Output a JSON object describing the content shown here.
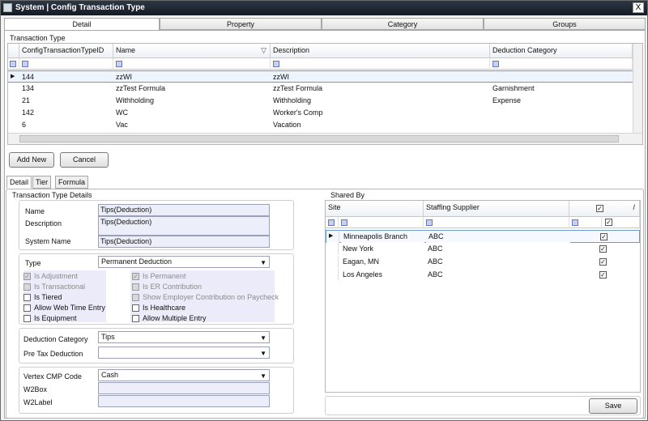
{
  "window": {
    "title": "System | Config Transaction Type",
    "close_glyph": "X"
  },
  "main_tabs": [
    "Detail",
    "Property",
    "Category",
    "Groups"
  ],
  "transaction_grid": {
    "section_label": "Transaction Type",
    "columns": [
      "ConfigTransactionTypeID",
      "Name",
      "Description",
      "Deduction Category"
    ],
    "rows": [
      [
        "144",
        "zzWI",
        "zzWI",
        ""
      ],
      [
        "134",
        "zzTest Formula",
        "zzTest Formula",
        "Garnishment"
      ],
      [
        "21",
        "Withholding",
        "Withholding",
        "Expense"
      ],
      [
        "142",
        "WC",
        "Worker's Comp",
        ""
      ],
      [
        "6",
        "Vac",
        "Vacation",
        ""
      ]
    ]
  },
  "buttons": {
    "add_new": "Add New",
    "cancel": "Cancel",
    "save": "Save"
  },
  "sub_tabs": [
    "Detail",
    "Tier",
    "Formula"
  ],
  "details": {
    "group_label": "Transaction Type Details",
    "name_label": "Name",
    "name_value": "Tips(Deduction)",
    "description_label": "Description",
    "description_value": "Tips(Deduction)",
    "system_name_label": "System Name",
    "system_name_value": "Tips(Deduction)",
    "type_label": "Type",
    "type_value": "Permanent Deduction",
    "checks": {
      "is_adjustment": "Is Adjustment",
      "is_permanent": "Is Permanent",
      "is_transactional": "Is Transactional",
      "is_er_contribution": "Is ER Contribution",
      "is_tiered": "Is Tiered",
      "show_employer": "Show Employer Contribution on Paycheck",
      "allow_web_time": "Allow Web Time Entry",
      "is_healthcare": "Is Healthcare",
      "is_equipment": "Is Equipment",
      "allow_multiple": "Allow Multiple Entry"
    },
    "deduction_category_label": "Deduction Category",
    "deduction_category_value": "Tips",
    "pre_tax_label": "Pre Tax Deduction",
    "pre_tax_value": "",
    "vertex_label": "Vertex CMP Code",
    "vertex_value": "Cash",
    "w2box_label": "W2Box",
    "w2label_label": "W2Label"
  },
  "shared_by": {
    "group_label": "Shared By",
    "columns": [
      "Site",
      "Staffing Supplier"
    ],
    "rows": [
      [
        "Minneapolis Branch",
        "ABC"
      ],
      [
        "New York",
        "ABC"
      ],
      [
        "Eagan, MN",
        "ABC"
      ],
      [
        "Los Angeles",
        "ABC"
      ]
    ]
  },
  "icons": {
    "check": "✓",
    "row_pointer": "▶",
    "filter": "▽",
    "dropdown": "▼",
    "header_check_glyph": "/"
  }
}
